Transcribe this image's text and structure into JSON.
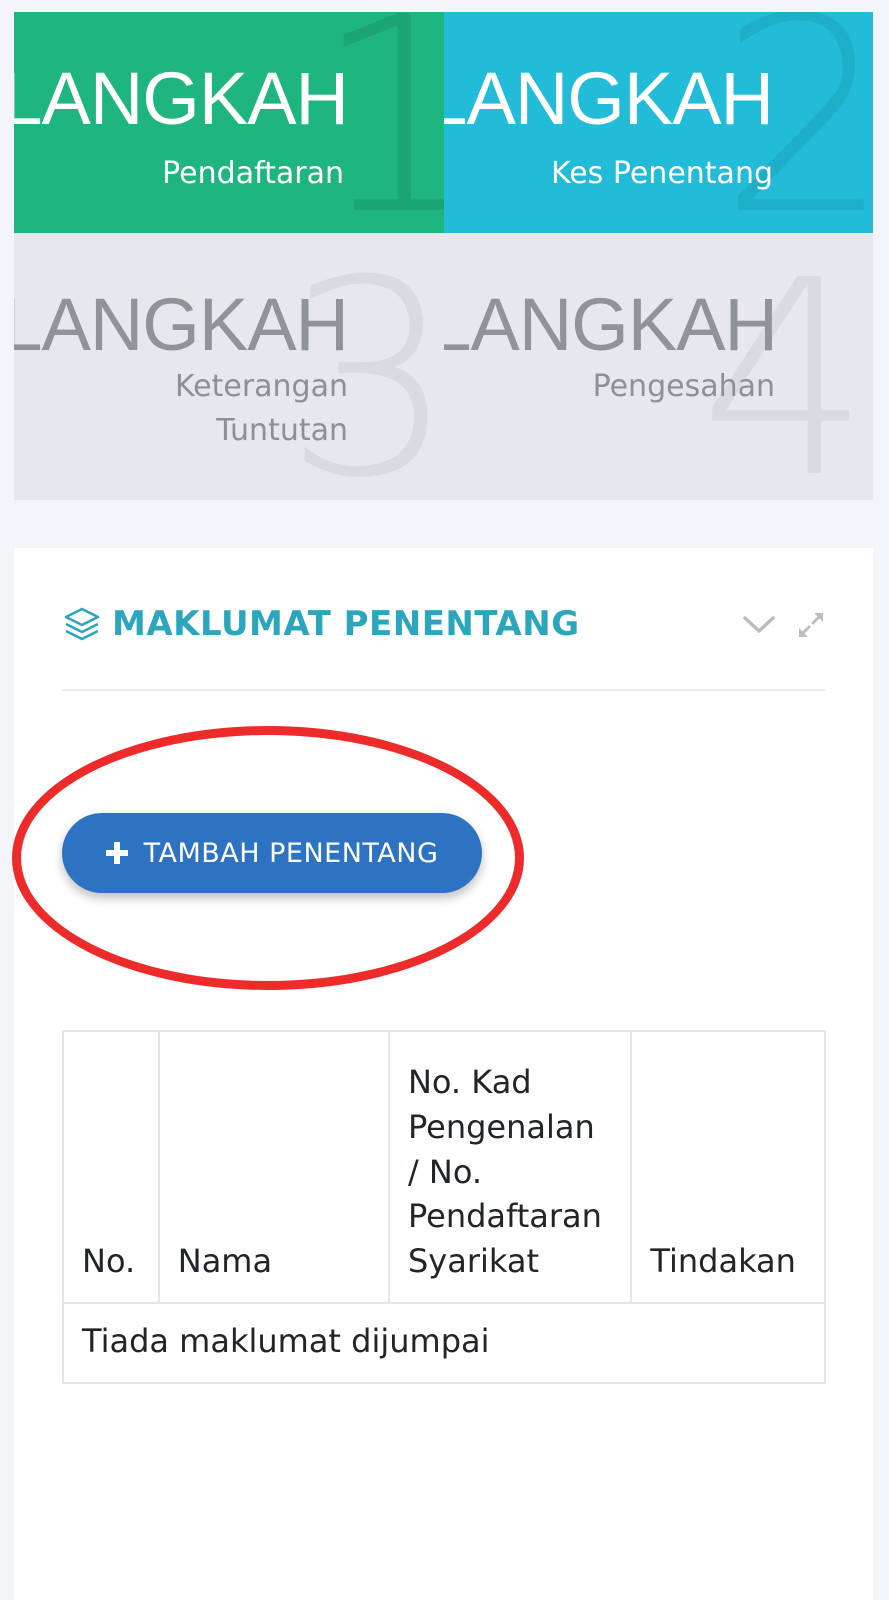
{
  "steps": [
    {
      "word": "LANGKAH",
      "number": "1",
      "label": "Pendaftaran",
      "state": "completed",
      "color": "#1fb57f"
    },
    {
      "word": "LANGKAH",
      "number": "2",
      "label": "Kes Penentang",
      "state": "active",
      "color": "#23bcd8"
    },
    {
      "word": "LANGKAH",
      "number": "3",
      "label_line1": "Keterangan",
      "label_line2": "Tuntutan",
      "state": "pending"
    },
    {
      "word": "LANGKAH",
      "number": "4",
      "label": "Pengesahan",
      "state": "pending"
    }
  ],
  "panel": {
    "title": "MAKLUMAT PENENTANG",
    "title_icon": "layers-icon",
    "collapse_icon": "chevron-down-icon",
    "expand_icon": "expand-icon",
    "accent_color": "#2ba6bc"
  },
  "add_button": {
    "label": "TAMBAH PENENTANG",
    "icon": "plus-icon",
    "color": "#2e72c2",
    "highlight_color": "#ee2b2b"
  },
  "table": {
    "headers": [
      "No.",
      "Nama",
      "No. Kad Pengenalan / No. Pendaftaran Syarikat",
      "Tindakan"
    ],
    "empty_message": "Tiada maklumat dijumpai"
  }
}
